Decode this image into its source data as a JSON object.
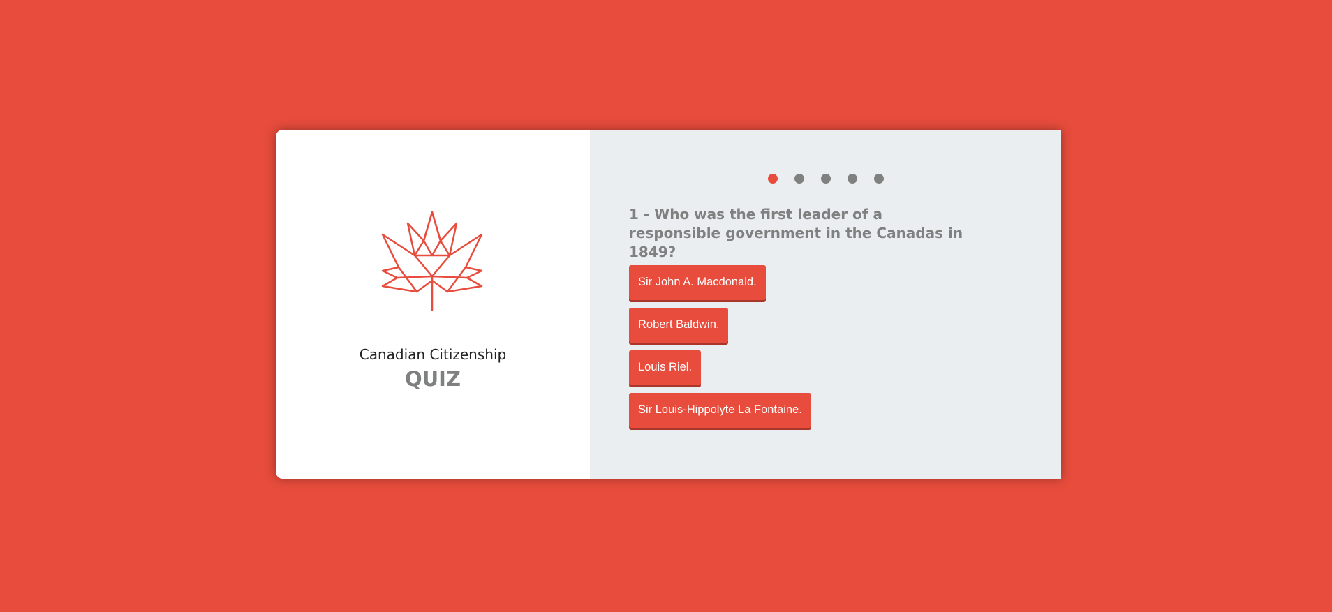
{
  "theme": {
    "accent": "#e74c3c",
    "background": "#e74c3c",
    "panel_right": "#eaeef0",
    "muted_text": "#7f8080"
  },
  "brand": {
    "logo_icon": "maple-leaf-icon",
    "subtitle": "Canadian Citizenship",
    "title": "QUIZ"
  },
  "progress": {
    "total": 5,
    "current": 1
  },
  "question": {
    "text": "1 - Who was the first leader of a responsible government in the Canadas in 1849?"
  },
  "answers": [
    "Sir John A. Macdonald.",
    "Robert Baldwin.",
    "Louis Riel.",
    "Sir Louis-Hippolyte La Fontaine."
  ]
}
